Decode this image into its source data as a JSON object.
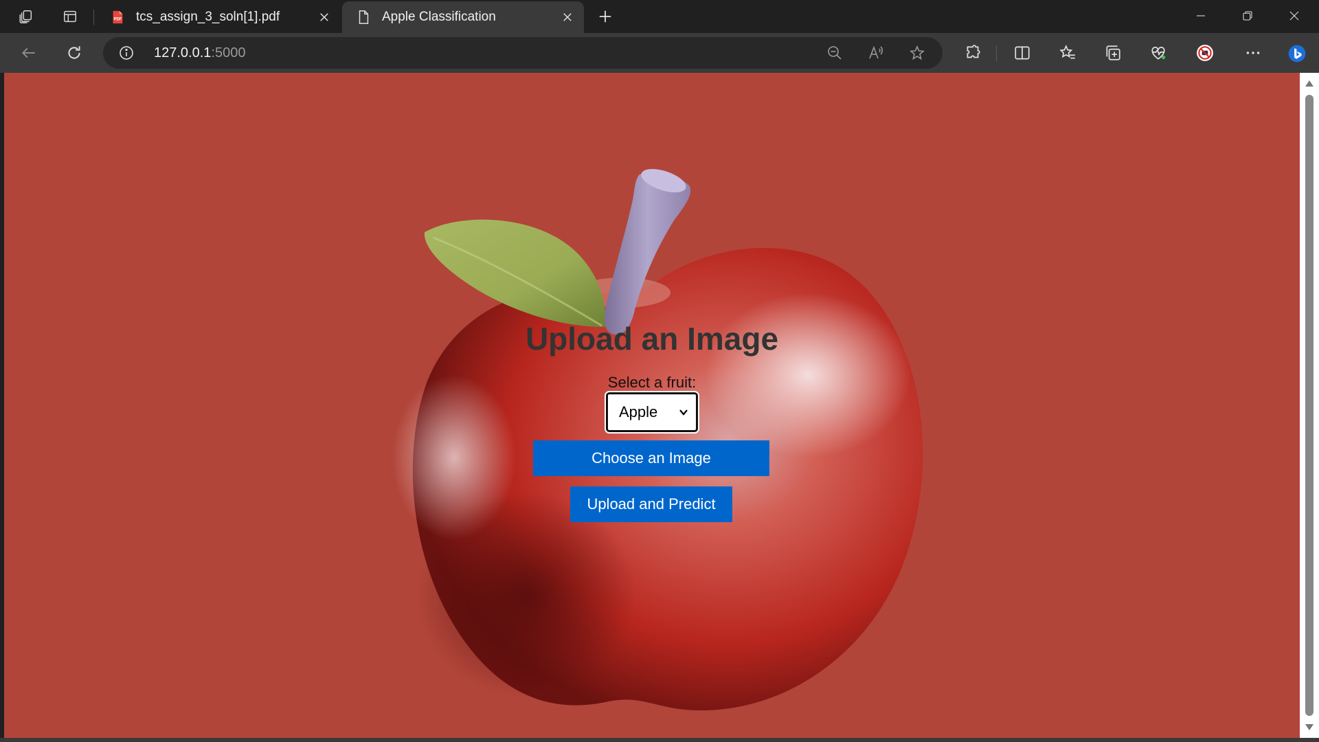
{
  "browser": {
    "tabs": [
      {
        "title": "tcs_assign_3_soln[1].pdf",
        "icon": "pdf-icon",
        "active": false
      },
      {
        "title": "Apple Classification",
        "icon": "page-icon",
        "active": true
      }
    ],
    "address": {
      "host": "127.0.0.1",
      "port": ":5000"
    }
  },
  "page": {
    "heading": "Upload an Image",
    "fruit_label": "Select a fruit:",
    "fruit_select": {
      "selected": "Apple"
    },
    "choose_button": "Choose an Image",
    "upload_button": "Upload and Predict"
  },
  "colors": {
    "page_background": "#b2453a",
    "button_blue": "#0066cc",
    "apple_red": "#c0392b",
    "leaf_green": "#9aab54",
    "stem_lavender": "#a89cc8"
  }
}
